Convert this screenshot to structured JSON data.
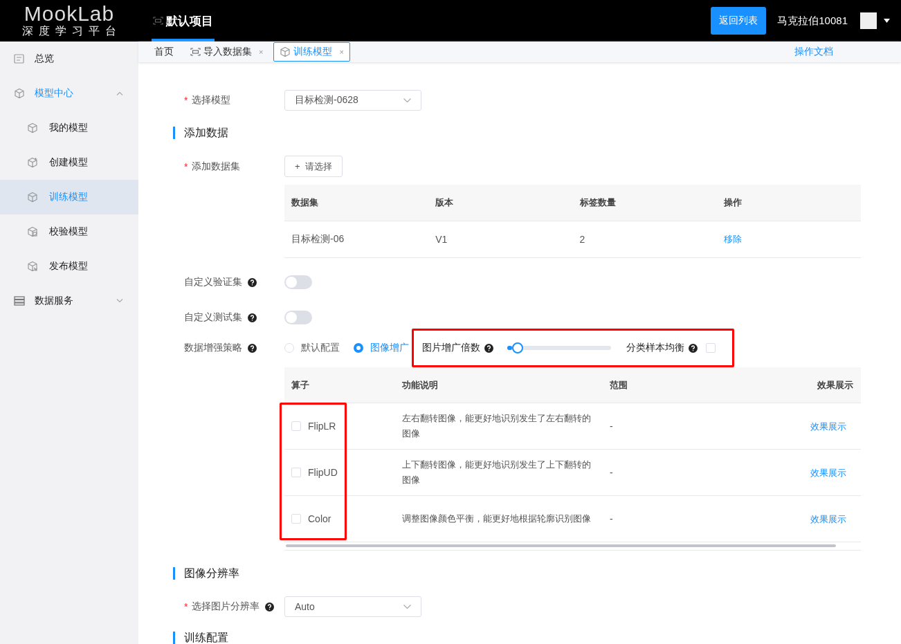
{
  "header": {
    "logo": "MookLab",
    "logo_subtitle": "深度学习平台",
    "nav": [
      {
        "label": "默认项目",
        "selected": true
      }
    ],
    "back_button": "返回列表",
    "username": "马克拉伯10081"
  },
  "sidebar": {
    "items": [
      {
        "label": "总览",
        "kind": "overview",
        "selected": false
      },
      {
        "label": "模型中心",
        "kind": "cube",
        "selected": true,
        "expanded": true,
        "children": [
          {
            "label": "我的模型",
            "kind": "cube",
            "selected": false
          },
          {
            "label": "创建模型",
            "kind": "cube-plus",
            "selected": false
          },
          {
            "label": "训练模型",
            "kind": "cube",
            "selected": true
          },
          {
            "label": "校验模型",
            "kind": "cube-check",
            "selected": false
          },
          {
            "label": "发布模型",
            "kind": "cube-arrow",
            "selected": false
          }
        ]
      },
      {
        "label": "数据服务",
        "kind": "data",
        "selected": false,
        "expanded": false
      }
    ]
  },
  "tabs": [
    {
      "label": "首页",
      "kind": "home",
      "selected": false
    },
    {
      "label": "导入数据集",
      "kind": "dataset",
      "selected": false,
      "close": "×"
    },
    {
      "label": "训练模型",
      "kind": "model",
      "selected": true,
      "close": "×"
    }
  ],
  "doc_link": "操作文档",
  "form": {
    "model": {
      "mark": "*",
      "label": "选择模型",
      "value": "目标检测-0628"
    },
    "data_heading": "添加数据",
    "dataset": {
      "mark": "*",
      "label": "添加数据集",
      "button_icon": "+",
      "button": "请选择"
    },
    "dataset_table": {
      "columns": [
        "数据集",
        "版本",
        "标签数量",
        "操作"
      ],
      "rows": [
        {
          "cells": [
            "目标检测-06",
            "V1",
            "2"
          ],
          "action": "移除"
        }
      ]
    },
    "custom_validation": {
      "label": "自定义验证集",
      "on": false
    },
    "custom_test": {
      "label": "自定义测试集",
      "on": false
    },
    "augmentation": {
      "label": "数据增强策略",
      "options": [
        {
          "label": "默认配置",
          "selected": false
        },
        {
          "label": "图像增广",
          "selected": true
        }
      ],
      "highlighted": true,
      "factor_label": "图片增广倍数",
      "level": 0.1,
      "balance_label": "分类样本均衡",
      "balance_checked": false
    },
    "operator_table": {
      "columns": [
        "算子",
        "功能说明",
        "范围",
        "效果展示"
      ],
      "highlight_first_column": true,
      "rows": [
        {
          "name": "FlipLR",
          "checked": false,
          "description": "左右翻转图像，能更好地识别发生了左右翻转的图像",
          "range": "-",
          "action": "效果展示"
        },
        {
          "name": "FlipUD",
          "checked": false,
          "description": "上下翻转图像，能更好地识别发生了上下翻转的图像",
          "range": "-",
          "action": "效果展示"
        },
        {
          "name": "Color",
          "checked": false,
          "description": "调整图像颜色平衡，能更好地根据轮廓识别图像",
          "range": "-",
          "action": "效果展示"
        }
      ]
    },
    "resolution_heading": "图像分辨率",
    "resolution": {
      "mark": "*",
      "label": "选择图片分辨率",
      "value": "Auto"
    },
    "training_heading": "训练配置"
  }
}
